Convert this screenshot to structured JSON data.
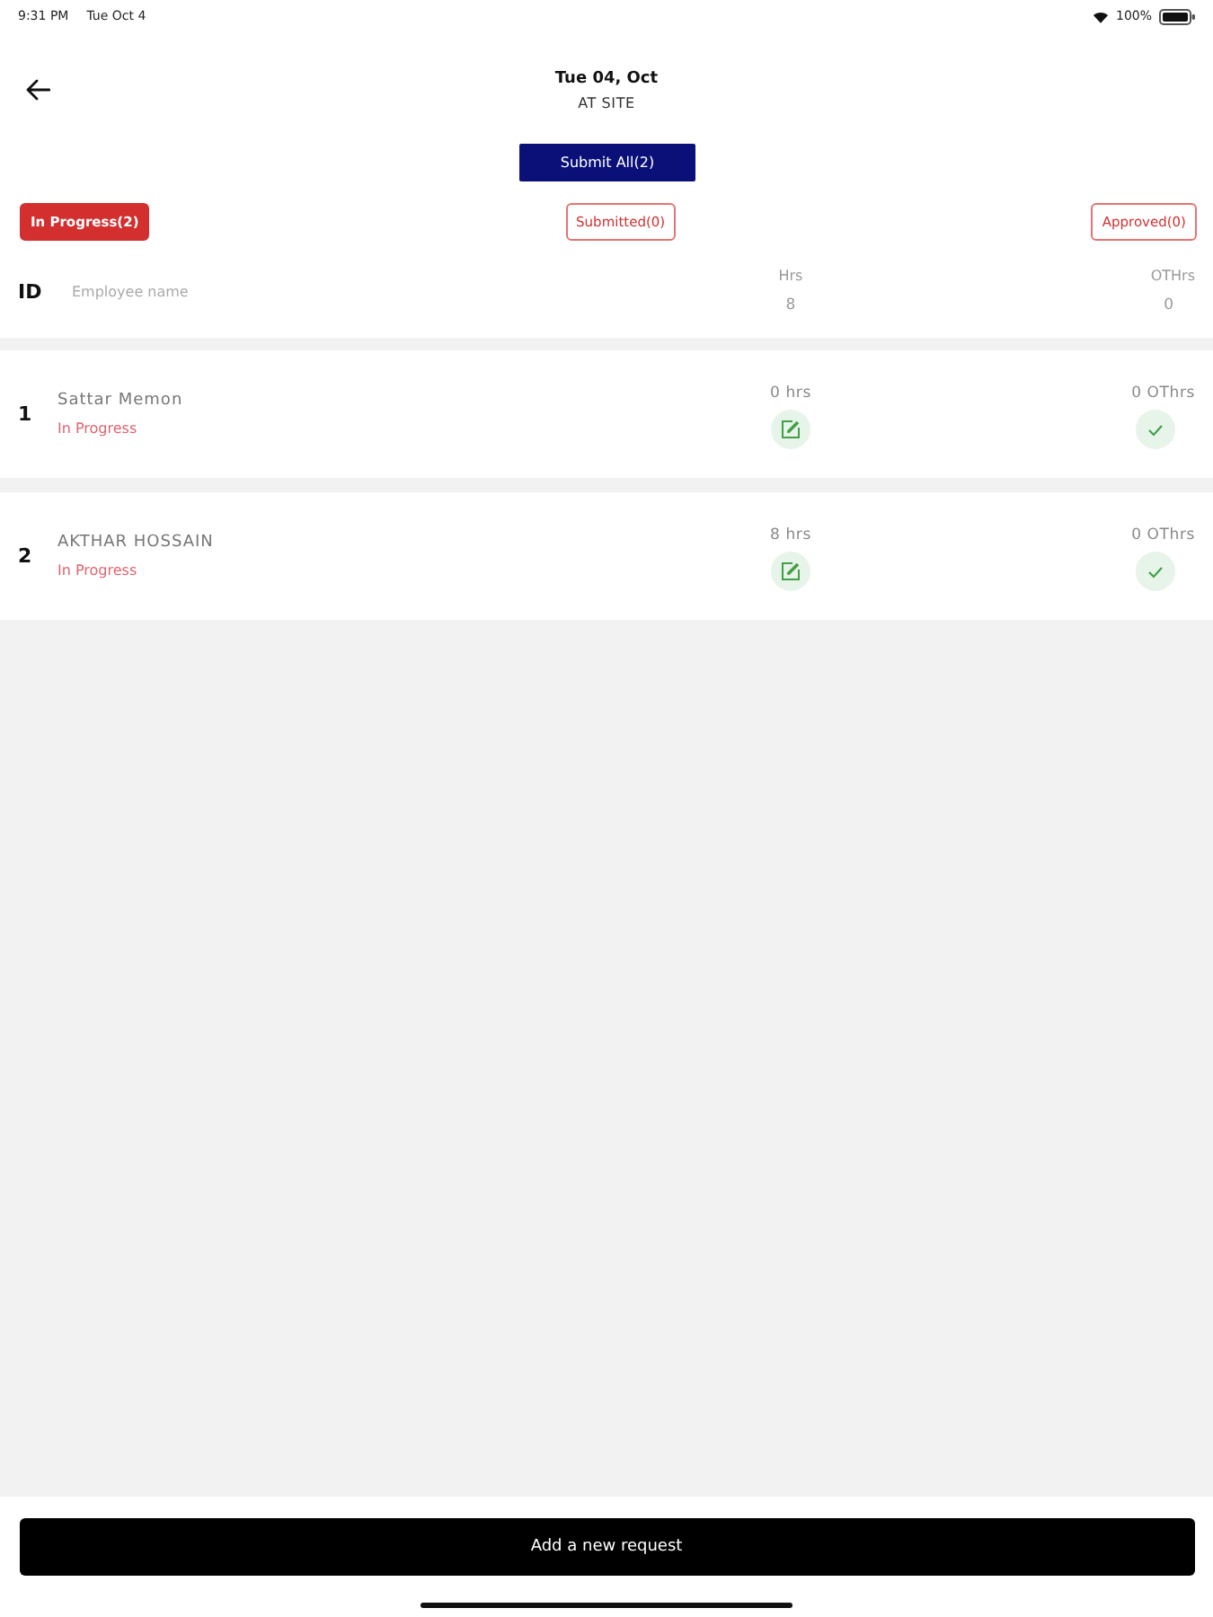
{
  "status_bar": {
    "time": "9:31 PM",
    "date": "Tue Oct 4",
    "battery_text": "100%"
  },
  "header": {
    "title": "Tue 04, Oct",
    "subtitle": "AT SITE"
  },
  "submit_button": {
    "label": "Submit All(2)"
  },
  "tabs": [
    {
      "label": "In Progress(2)",
      "selected": true
    },
    {
      "label": "Submitted(0)",
      "selected": false
    },
    {
      "label": "Approved(0)",
      "selected": false
    }
  ],
  "table": {
    "columns": [
      {
        "label": "ID"
      },
      {
        "label": "Employee name"
      },
      {
        "label": "Hrs",
        "total": "8"
      },
      {
        "label": "OTHrs",
        "total": "0"
      }
    ],
    "rows": [
      {
        "id": "1",
        "name": "Sattar Memon",
        "status": "In Progress",
        "hours": "0 hrs",
        "ot_hours": "0 OThrs"
      },
      {
        "id": "2",
        "name": "AKTHAR HOSSAIN",
        "status": "In Progress",
        "hours": "8 hrs",
        "ot_hours": "0 OThrs"
      }
    ]
  },
  "add_button": {
    "label": "Add a new request"
  }
}
